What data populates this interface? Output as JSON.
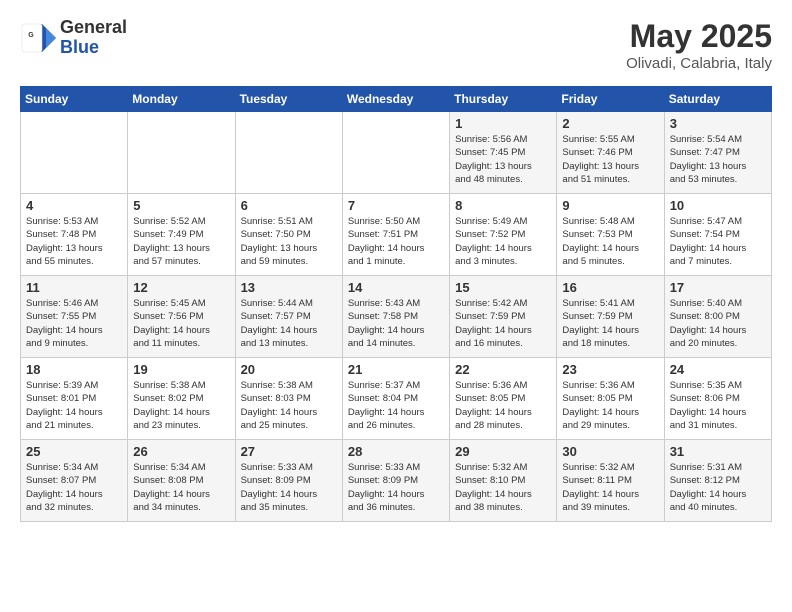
{
  "header": {
    "logo_general": "General",
    "logo_blue": "Blue",
    "title": "May 2025",
    "subtitle": "Olivadi, Calabria, Italy"
  },
  "days_of_week": [
    "Sunday",
    "Monday",
    "Tuesday",
    "Wednesday",
    "Thursday",
    "Friday",
    "Saturday"
  ],
  "weeks": [
    [
      {
        "day": "",
        "info": ""
      },
      {
        "day": "",
        "info": ""
      },
      {
        "day": "",
        "info": ""
      },
      {
        "day": "",
        "info": ""
      },
      {
        "day": "1",
        "info": "Sunrise: 5:56 AM\nSunset: 7:45 PM\nDaylight: 13 hours\nand 48 minutes."
      },
      {
        "day": "2",
        "info": "Sunrise: 5:55 AM\nSunset: 7:46 PM\nDaylight: 13 hours\nand 51 minutes."
      },
      {
        "day": "3",
        "info": "Sunrise: 5:54 AM\nSunset: 7:47 PM\nDaylight: 13 hours\nand 53 minutes."
      }
    ],
    [
      {
        "day": "4",
        "info": "Sunrise: 5:53 AM\nSunset: 7:48 PM\nDaylight: 13 hours\nand 55 minutes."
      },
      {
        "day": "5",
        "info": "Sunrise: 5:52 AM\nSunset: 7:49 PM\nDaylight: 13 hours\nand 57 minutes."
      },
      {
        "day": "6",
        "info": "Sunrise: 5:51 AM\nSunset: 7:50 PM\nDaylight: 13 hours\nand 59 minutes."
      },
      {
        "day": "7",
        "info": "Sunrise: 5:50 AM\nSunset: 7:51 PM\nDaylight: 14 hours\nand 1 minute."
      },
      {
        "day": "8",
        "info": "Sunrise: 5:49 AM\nSunset: 7:52 PM\nDaylight: 14 hours\nand 3 minutes."
      },
      {
        "day": "9",
        "info": "Sunrise: 5:48 AM\nSunset: 7:53 PM\nDaylight: 14 hours\nand 5 minutes."
      },
      {
        "day": "10",
        "info": "Sunrise: 5:47 AM\nSunset: 7:54 PM\nDaylight: 14 hours\nand 7 minutes."
      }
    ],
    [
      {
        "day": "11",
        "info": "Sunrise: 5:46 AM\nSunset: 7:55 PM\nDaylight: 14 hours\nand 9 minutes."
      },
      {
        "day": "12",
        "info": "Sunrise: 5:45 AM\nSunset: 7:56 PM\nDaylight: 14 hours\nand 11 minutes."
      },
      {
        "day": "13",
        "info": "Sunrise: 5:44 AM\nSunset: 7:57 PM\nDaylight: 14 hours\nand 13 minutes."
      },
      {
        "day": "14",
        "info": "Sunrise: 5:43 AM\nSunset: 7:58 PM\nDaylight: 14 hours\nand 14 minutes."
      },
      {
        "day": "15",
        "info": "Sunrise: 5:42 AM\nSunset: 7:59 PM\nDaylight: 14 hours\nand 16 minutes."
      },
      {
        "day": "16",
        "info": "Sunrise: 5:41 AM\nSunset: 7:59 PM\nDaylight: 14 hours\nand 18 minutes."
      },
      {
        "day": "17",
        "info": "Sunrise: 5:40 AM\nSunset: 8:00 PM\nDaylight: 14 hours\nand 20 minutes."
      }
    ],
    [
      {
        "day": "18",
        "info": "Sunrise: 5:39 AM\nSunset: 8:01 PM\nDaylight: 14 hours\nand 21 minutes."
      },
      {
        "day": "19",
        "info": "Sunrise: 5:38 AM\nSunset: 8:02 PM\nDaylight: 14 hours\nand 23 minutes."
      },
      {
        "day": "20",
        "info": "Sunrise: 5:38 AM\nSunset: 8:03 PM\nDaylight: 14 hours\nand 25 minutes."
      },
      {
        "day": "21",
        "info": "Sunrise: 5:37 AM\nSunset: 8:04 PM\nDaylight: 14 hours\nand 26 minutes."
      },
      {
        "day": "22",
        "info": "Sunrise: 5:36 AM\nSunset: 8:05 PM\nDaylight: 14 hours\nand 28 minutes."
      },
      {
        "day": "23",
        "info": "Sunrise: 5:36 AM\nSunset: 8:05 PM\nDaylight: 14 hours\nand 29 minutes."
      },
      {
        "day": "24",
        "info": "Sunrise: 5:35 AM\nSunset: 8:06 PM\nDaylight: 14 hours\nand 31 minutes."
      }
    ],
    [
      {
        "day": "25",
        "info": "Sunrise: 5:34 AM\nSunset: 8:07 PM\nDaylight: 14 hours\nand 32 minutes."
      },
      {
        "day": "26",
        "info": "Sunrise: 5:34 AM\nSunset: 8:08 PM\nDaylight: 14 hours\nand 34 minutes."
      },
      {
        "day": "27",
        "info": "Sunrise: 5:33 AM\nSunset: 8:09 PM\nDaylight: 14 hours\nand 35 minutes."
      },
      {
        "day": "28",
        "info": "Sunrise: 5:33 AM\nSunset: 8:09 PM\nDaylight: 14 hours\nand 36 minutes."
      },
      {
        "day": "29",
        "info": "Sunrise: 5:32 AM\nSunset: 8:10 PM\nDaylight: 14 hours\nand 38 minutes."
      },
      {
        "day": "30",
        "info": "Sunrise: 5:32 AM\nSunset: 8:11 PM\nDaylight: 14 hours\nand 39 minutes."
      },
      {
        "day": "31",
        "info": "Sunrise: 5:31 AM\nSunset: 8:12 PM\nDaylight: 14 hours\nand 40 minutes."
      }
    ]
  ]
}
